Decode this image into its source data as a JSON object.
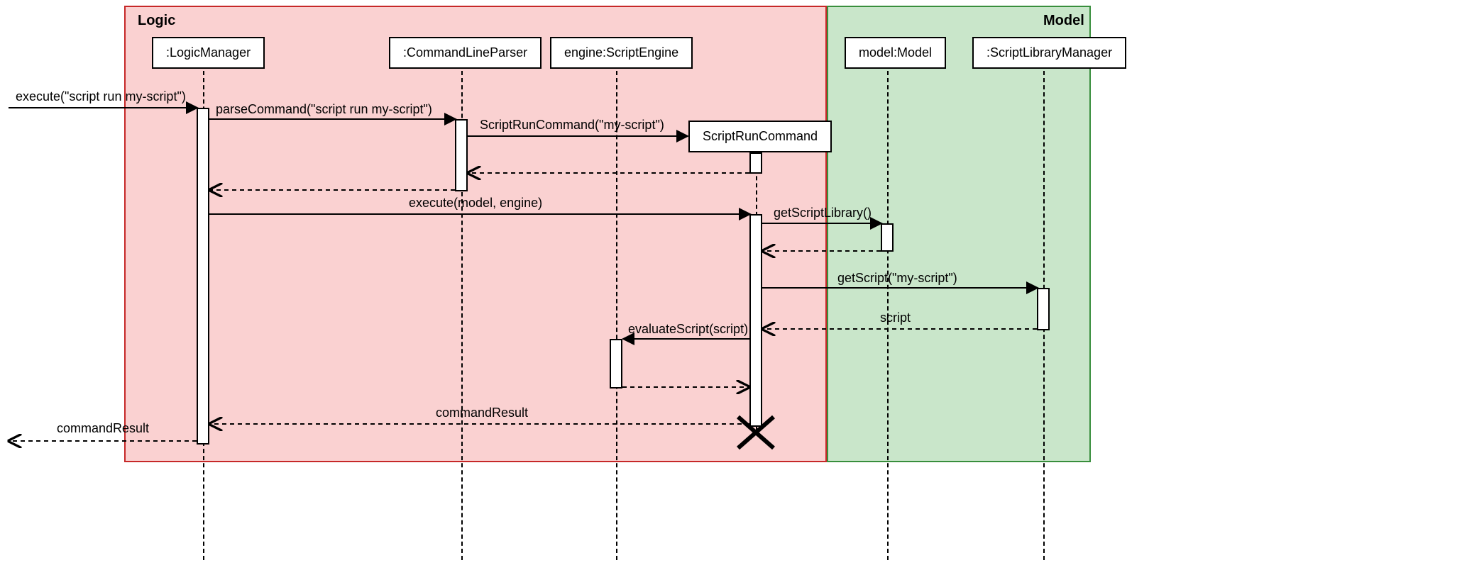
{
  "regions": {
    "logic": {
      "label": "Logic"
    },
    "model": {
      "label": "Model"
    }
  },
  "participants": {
    "logicManager": ":LogicManager",
    "commandLineParser": ":CommandLineParser",
    "scriptEngine": "engine:ScriptEngine",
    "scriptRunCommand": "ScriptRunCommand",
    "model": "model:Model",
    "scriptLibraryManager": ":ScriptLibraryManager"
  },
  "messages": {
    "execIn": "execute(\"script run my-script\")",
    "parseCommand": "parseCommand(\"script run my-script\")",
    "scriptRunCommandNew": "ScriptRunCommand(\"my-script\")",
    "executeModelEngine": "execute(model, engine)",
    "getScriptLibrary": "getScriptLibrary()",
    "getScript": "getScript(\"my-script\")",
    "scriptReturn": "script",
    "evaluateScript": "evaluateScript(script)",
    "commandResultInner": "commandResult",
    "commandResultOut": "commandResult"
  },
  "chart_data": {
    "type": "sequence_diagram",
    "regions": [
      {
        "name": "Logic",
        "participants": [
          ":LogicManager",
          ":CommandLineParser",
          "engine:ScriptEngine",
          "ScriptRunCommand"
        ]
      },
      {
        "name": "Model",
        "participants": [
          "model:Model",
          ":ScriptLibraryManager"
        ]
      }
    ],
    "participants": [
      ":LogicManager",
      ":CommandLineParser",
      "engine:ScriptEngine",
      "ScriptRunCommand",
      "model:Model",
      ":ScriptLibraryManager"
    ],
    "created_during_sequence": [
      "ScriptRunCommand"
    ],
    "destroyed": [
      "ScriptRunCommand"
    ],
    "messages": [
      {
        "from": "external",
        "to": ":LogicManager",
        "label": "execute(\"script run my-script\")",
        "kind": "sync"
      },
      {
        "from": ":LogicManager",
        "to": ":CommandLineParser",
        "label": "parseCommand(\"script run my-script\")",
        "kind": "sync"
      },
      {
        "from": ":CommandLineParser",
        "to": "ScriptRunCommand",
        "label": "ScriptRunCommand(\"my-script\")",
        "kind": "create"
      },
      {
        "from": "ScriptRunCommand",
        "to": ":CommandLineParser",
        "label": "",
        "kind": "return"
      },
      {
        "from": ":CommandLineParser",
        "to": ":LogicManager",
        "label": "",
        "kind": "return"
      },
      {
        "from": ":LogicManager",
        "to": "ScriptRunCommand",
        "label": "execute(model, engine)",
        "kind": "sync"
      },
      {
        "from": "ScriptRunCommand",
        "to": "model:Model",
        "label": "getScriptLibrary()",
        "kind": "sync"
      },
      {
        "from": "model:Model",
        "to": "ScriptRunCommand",
        "label": "",
        "kind": "return"
      },
      {
        "from": "ScriptRunCommand",
        "to": ":ScriptLibraryManager",
        "label": "getScript(\"my-script\")",
        "kind": "sync"
      },
      {
        "from": ":ScriptLibraryManager",
        "to": "ScriptRunCommand",
        "label": "script",
        "kind": "return"
      },
      {
        "from": "ScriptRunCommand",
        "to": "engine:ScriptEngine",
        "label": "evaluateScript(script)",
        "kind": "sync"
      },
      {
        "from": "engine:ScriptEngine",
        "to": "ScriptRunCommand",
        "label": "",
        "kind": "return"
      },
      {
        "from": "ScriptRunCommand",
        "to": ":LogicManager",
        "label": "commandResult",
        "kind": "return"
      },
      {
        "from": ":LogicManager",
        "to": "external",
        "label": "commandResult",
        "kind": "return"
      }
    ]
  }
}
